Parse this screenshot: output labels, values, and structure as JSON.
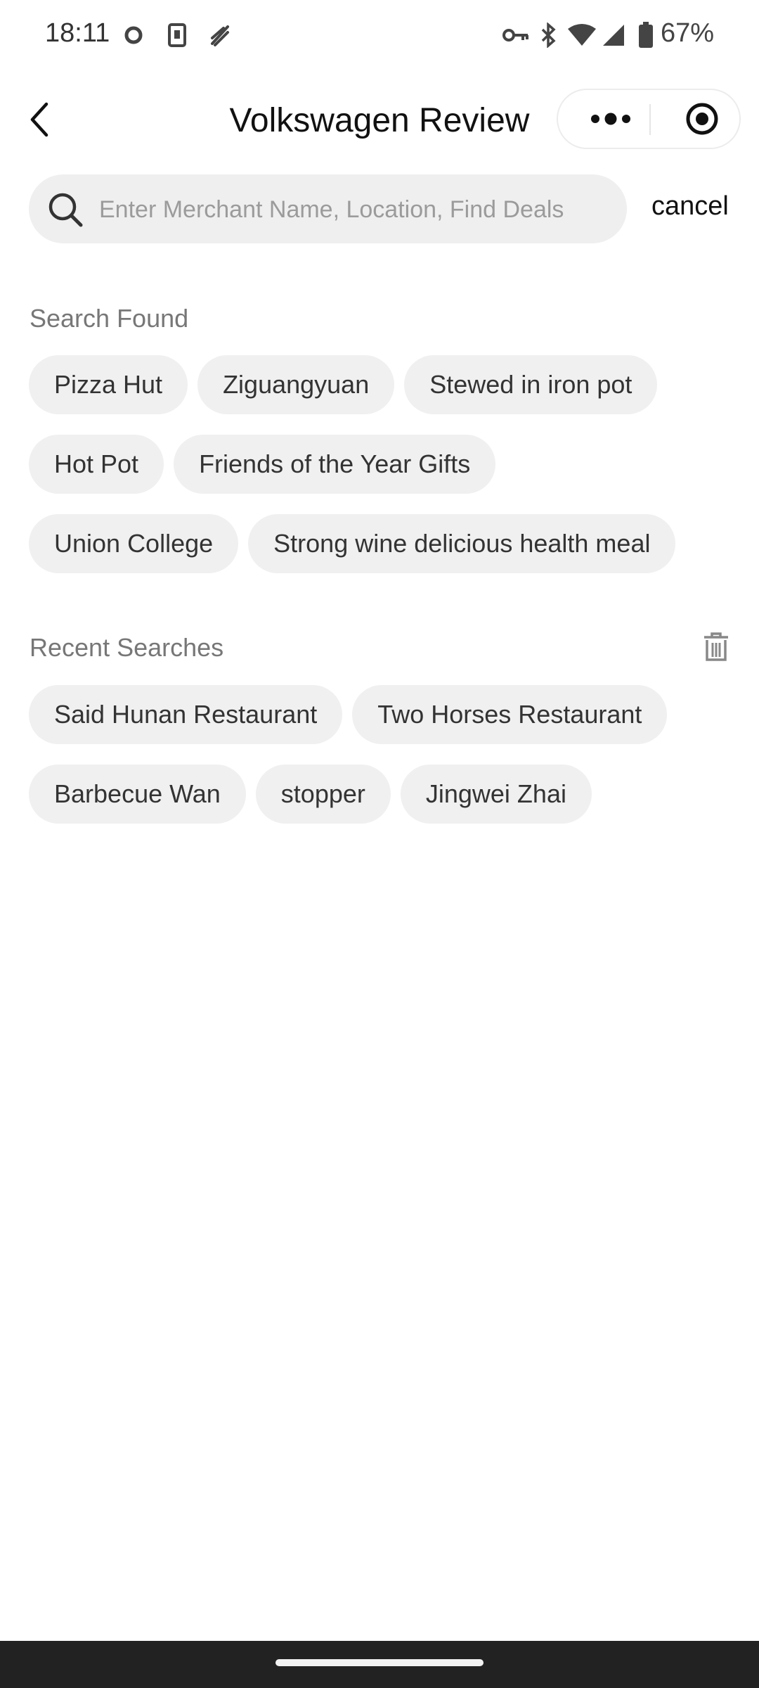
{
  "status_bar": {
    "time": "18:11",
    "battery_text": "67%",
    "icons": [
      "circle-notification-icon",
      "sim-card-icon",
      "leaf-icon",
      "key-icon",
      "bluetooth-icon",
      "wifi-icon",
      "signal-icon",
      "battery-icon"
    ]
  },
  "nav": {
    "title": "Volkswagen Review",
    "back_icon": "chevron-left-icon",
    "more_icon": "more-dots-icon",
    "close_icon": "target-icon"
  },
  "search": {
    "placeholder": "Enter Merchant Name, Location, Find Deals",
    "value": "",
    "cancel_label": "cancel"
  },
  "search_found": {
    "title": "Search Found",
    "rows": [
      [
        "Pizza Hut",
        "Ziguangyuan",
        "Stewed in iron pot"
      ],
      [
        "Hot Pot",
        "Friends of the Year Gifts"
      ],
      [
        "Union College",
        "Strong wine delicious health meal"
      ]
    ]
  },
  "recent_searches": {
    "title": "Recent Searches",
    "clear_icon": "trash-icon",
    "rows": [
      [
        "Said Hunan Restaurant",
        "Two Horses Restaurant"
      ],
      [
        "Barbecue Wan",
        "stopper",
        "Jingwei Zhai"
      ]
    ]
  }
}
